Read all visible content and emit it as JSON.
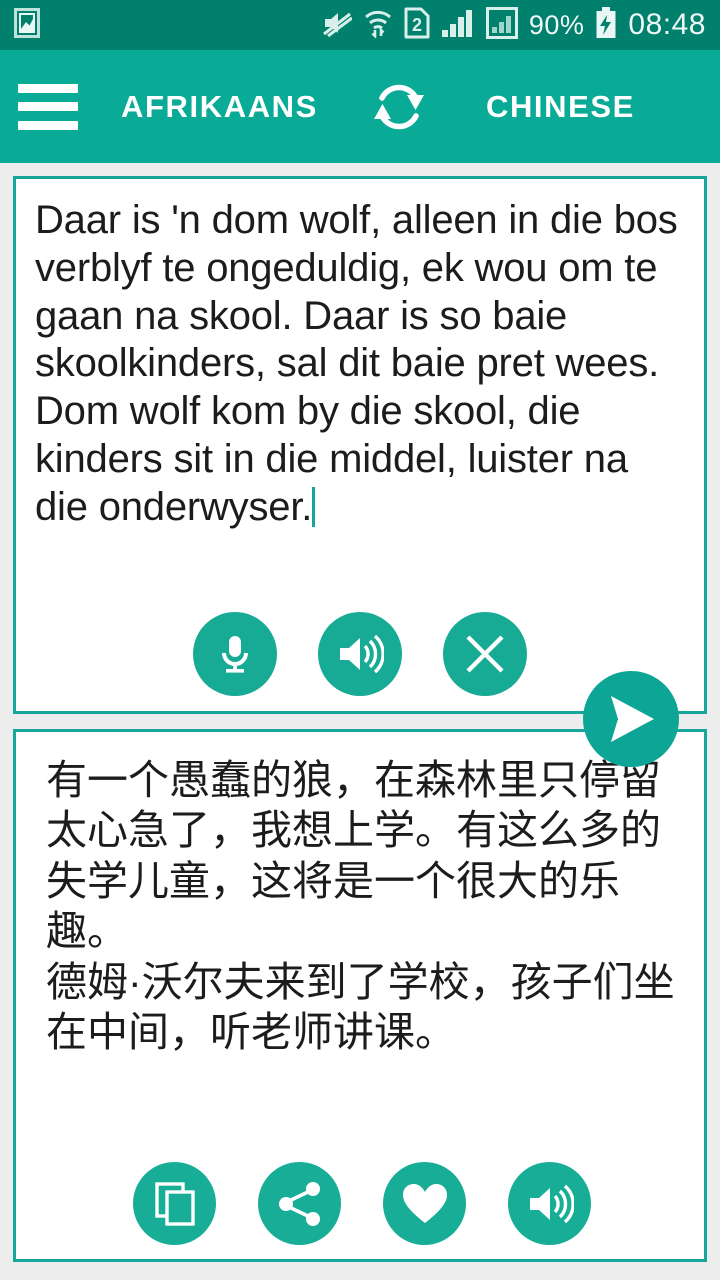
{
  "statusbar": {
    "icons_left": [
      "screenshot-image-icon"
    ],
    "icons_right": [
      "mute-icon",
      "wifi-icon",
      "sim2-icon",
      "signal-bars-icon",
      "signal-bars-2-icon"
    ],
    "sim_label": "2",
    "battery_percent": "90%",
    "battery_state": "charging-bolt-icon",
    "clock": "08:48",
    "bg_color": "#00806d"
  },
  "appbar": {
    "menu_icon": "hamburger-menu-icon",
    "source_language": "AFRIKAANS",
    "swap_icon": "swap-languages-icon",
    "target_language": "CHINESE",
    "bg_color": "#0aab96"
  },
  "source_card": {
    "text": "Daar is 'n dom wolf, alleen in die bos verblyf te ongeduldig, ek wou om te gaan na skool. Daar is so baie skoolkinders, sal dit baie pret wees.\nDom wolf kom by die skool, die kinders sit in die middel, luister na die onderwyser.",
    "caret_visible": true,
    "actions": [
      {
        "name": "microphone-button",
        "icon": "microphone-icon",
        "label": "Speak"
      },
      {
        "name": "speak-source-button",
        "icon": "volume-icon",
        "label": "Listen"
      },
      {
        "name": "clear-source-button",
        "icon": "close-icon",
        "label": "Clear"
      }
    ]
  },
  "send_button": {
    "icon": "send-icon",
    "label": "Translate",
    "color": "#0da595"
  },
  "target_card": {
    "text": "有一个愚蠢的狼，在森林里只停留太心急了，我想上学。有这么多的失学儿童，这将是一个很大的乐趣。\n德姆·沃尔夫来到了学校，孩子们坐在中间，听老师讲课。",
    "actions": [
      {
        "name": "copy-button",
        "icon": "copy-icon",
        "label": "Copy"
      },
      {
        "name": "share-button",
        "icon": "share-icon",
        "label": "Share"
      },
      {
        "name": "favorite-button",
        "icon": "heart-icon",
        "label": "Favorite"
      },
      {
        "name": "speak-target-button",
        "icon": "volume-icon",
        "label": "Listen"
      }
    ]
  },
  "theme": {
    "accent": "#16a79a",
    "card_bg": "#ffffff",
    "page_bg": "#ededed"
  }
}
